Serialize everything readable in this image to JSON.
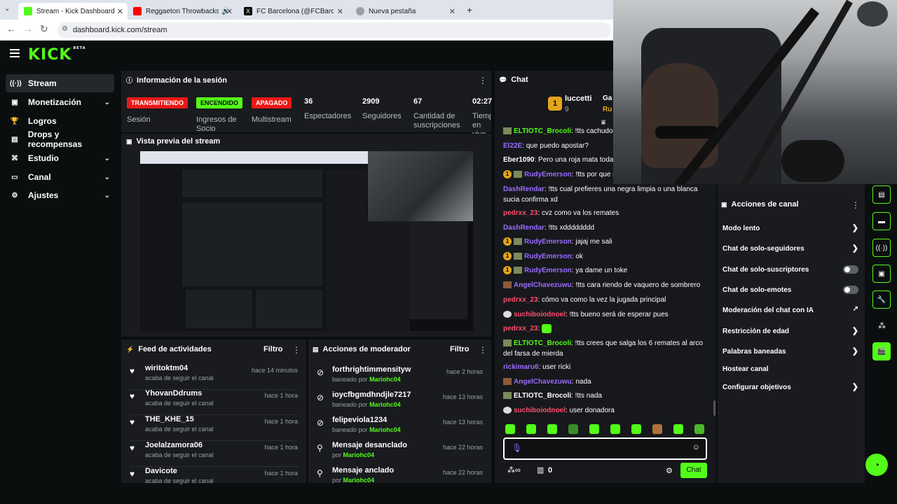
{
  "browser": {
    "tabs": [
      {
        "title": "Stream - Kick Dashboard"
      },
      {
        "title": "Reggaeton Throwbacks | Da"
      },
      {
        "title": "FC Barcelona (@FCBarcelona_e"
      },
      {
        "title": "Nueva pestaña"
      }
    ],
    "url": "dashboard.kick.com/stream"
  },
  "brand": {
    "logo": "KICK",
    "logo_sup": "BETA",
    "accent": "#53fc18"
  },
  "sidebar": {
    "items": [
      {
        "label": "Stream",
        "icon": "broadcast-icon"
      },
      {
        "label": "Monetización",
        "icon": "money-icon"
      },
      {
        "label": "Logros",
        "icon": "trophy-icon"
      },
      {
        "label": "Drops y recompensas",
        "icon": "gift-icon"
      },
      {
        "label": "Estudio",
        "icon": "studio-icon"
      },
      {
        "label": "Canal",
        "icon": "channel-icon"
      },
      {
        "label": "Ajustes",
        "icon": "gear-icon"
      }
    ]
  },
  "session": {
    "title": "Información de la sesión",
    "badges": [
      {
        "text": "TRANSMITIENDO",
        "label": "Sesión",
        "color": "#e91916"
      },
      {
        "text": "ENCENDIDO",
        "label": "Ingresos de Socio",
        "color": "#53fc18"
      },
      {
        "text": "APAGADO",
        "label": "Multistream",
        "color": "#e91916"
      }
    ],
    "stats": [
      {
        "value": "36",
        "label": "Espectadores"
      },
      {
        "value": "2909",
        "label": "Seguidores"
      },
      {
        "value": "67",
        "label": "Cantidad de suscripciones"
      },
      {
        "value": "02:27:",
        "label": "Tiempo en vivo"
      }
    ]
  },
  "preview": {
    "title": "Vista previa del stream"
  },
  "feed": {
    "title": "Feed de actividades",
    "filter": "Filtro",
    "items": [
      {
        "name": "wiritoktm04",
        "sub": "acaba de seguir el canal",
        "time": "hace 14 minutos"
      },
      {
        "name": "YhovanDdrums",
        "sub": "acaba de seguir el canal",
        "time": "hace 1 hora"
      },
      {
        "name": "THE_KHE_15",
        "sub": "acaba de seguir el canal",
        "time": "hace 1 hora"
      },
      {
        "name": "Joelalzamora06",
        "sub": "acaba de seguir el canal",
        "time": "hace 1 hora"
      },
      {
        "name": "Davicote",
        "sub": "acaba de seguir el canal",
        "time": "hace 1 hora"
      }
    ]
  },
  "mod": {
    "title": "Acciones de moderador",
    "filter": "Filtro",
    "items": [
      {
        "name": "forthrightimmensityw",
        "prefix": "baneado por",
        "by": "Mariohc04",
        "time": "hace 2 horas",
        "icon": "ban-icon"
      },
      {
        "name": "ioycfbgmdhndjle7217",
        "prefix": "baneado por",
        "by": "Mariohc04",
        "time": "hace 13 horas",
        "icon": "ban-icon"
      },
      {
        "name": "felipeviola1234",
        "prefix": "baneado por",
        "by": "Mariohc04",
        "time": "hace 13 horas",
        "icon": "ban-icon"
      },
      {
        "name": "Mensaje desanclado",
        "prefix": "por",
        "by": "Mariohc04",
        "time": "hace 22 horas",
        "icon": "unpin-icon"
      },
      {
        "name": "Mensaje anclado",
        "prefix": "por",
        "by": "Mariohc04",
        "time": "hace 22 horas",
        "icon": "pin-icon"
      }
    ]
  },
  "chat": {
    "title": "Chat",
    "leader": {
      "name": "luccetti",
      "count": "9",
      "rank": "1",
      "other1": "Ga",
      "other2": "Ru"
    },
    "messages": [
      {
        "user": "ELTIOTC_Brocoli",
        "color": "#53fc18",
        "text": "!tts cachudo",
        "badge": "emote"
      },
      {
        "user": "El22E",
        "color": "#9b6cff",
        "text": "que puedo apostar?"
      },
      {
        "user": "Eber1090",
        "color": "#ffffff",
        "text": "Pero una roja mata toda est"
      },
      {
        "user": "RudyEmerson",
        "color": "#9b6cff",
        "text": "!tts por que solo",
        "badge": "coin"
      },
      {
        "user": "DashRendar",
        "color": "#9b6cff",
        "text": "!tts cual prefieres una negra limpia o una blanca sucia confirma xd"
      },
      {
        "user": "pedrxx_23",
        "color": "#ff4d6d",
        "text": "cvz como va los remates"
      },
      {
        "user": "DashRendar",
        "color": "#9b6cff",
        "text": "!tts xdddddddd"
      },
      {
        "user": "RudyEmerson",
        "color": "#9b6cff",
        "text": "jajaj me sali",
        "badge": "coin"
      },
      {
        "user": "RudyEmerson",
        "color": "#9b6cff",
        "text": "ok",
        "badge": "coin"
      },
      {
        "user": "RudyEmerson",
        "color": "#9b6cff",
        "text": "ya dame un toke",
        "badge": "coin"
      },
      {
        "user": "AngelChavezuwu",
        "color": "#9b6cff",
        "text": "!tts cara riendo de vaquero de sombrero",
        "badge": "emote"
      },
      {
        "user": "pedrxx_23",
        "color": "#ff4d6d",
        "text": "cómo va como la vez la jugada principal"
      },
      {
        "user": "suchiboiodnoel",
        "color": "#ff4d6d",
        "text": "!tts bueno será de esperar pues",
        "badge": "emote"
      },
      {
        "user": "pedrxx_23",
        "color": "#ff4d6d",
        "text": ""
      },
      {
        "user": "ELTIOTC_Brocoli",
        "color": "#53fc18",
        "text": "!tts crees que salga los 6 remates al arco del farsa de mierda",
        "badge": "emote"
      },
      {
        "user": "rickimaru6",
        "color": "#9b6cff",
        "text": "user ricki"
      },
      {
        "user": "AngelChavezuwu",
        "color": "#9b6cff",
        "text": "nada",
        "badge": "emote"
      },
      {
        "user": "ELTIOTC_Brocoli",
        "color": "#ffffff",
        "text": "!tts nada",
        "badge": "emote"
      },
      {
        "user": "suchiboiodnoel",
        "color": "#ff4d6d",
        "text": "user donadora",
        "badge": "emote"
      }
    ],
    "input_placeholder": "",
    "points": "0",
    "send": "Chat"
  },
  "actions": {
    "title": "Acciones de canal",
    "items": [
      {
        "label": "Modo lento",
        "type": "chevron"
      },
      {
        "label": "Chat de solo-seguidores",
        "type": "chevron"
      },
      {
        "label": "Chat de solo-suscriptores",
        "type": "toggle"
      },
      {
        "label": "Chat de solo-emotes",
        "type": "toggle"
      },
      {
        "label": "Moderación del chat con IA",
        "type": "external"
      },
      {
        "label": "Restricción de edad",
        "type": "chevron"
      },
      {
        "label": "Palabras baneadas",
        "type": "chevron"
      },
      {
        "label": "Hostear canal",
        "type": "none"
      },
      {
        "label": "Configurar objetivos",
        "type": "chevron"
      }
    ]
  }
}
